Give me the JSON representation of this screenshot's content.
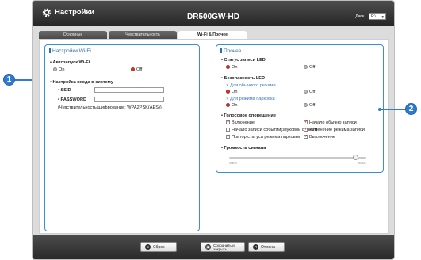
{
  "header": {
    "app_title": "Настройки",
    "model": "DR500GW-HD",
    "disk_label": "Диск :",
    "disk_value": "F:\\"
  },
  "tabs": [
    {
      "label": "Основные"
    },
    {
      "label": "Чувствительность"
    },
    {
      "label": "Wi-Fi & Прочее",
      "active": true
    }
  ],
  "wifi": {
    "title": "Настройки Wi-Fi",
    "autostart_label": "• Автозапуск Wi-Fi",
    "on_label": "On",
    "off_label": "Off",
    "autostart_value": "Off",
    "login_label": "• Настройка входа в систему",
    "ssid_label": "• SSID",
    "ssid_value": "",
    "password_label": "• PASSWORD",
    "password_value": "",
    "hint": "(Чувствительность/шифрование: WPA2PSK(AES))"
  },
  "misc": {
    "title": "Прочее",
    "led_label": "• Статус записи LED",
    "led_value": "On",
    "security_led_label": "• Безопасность LED",
    "normal_mode_label": "Для обычного режима",
    "normal_mode_value": "On",
    "parking_mode_label": "Для режима парковки",
    "parking_mode_value": "On",
    "on_label": "On",
    "off_label": "Off",
    "voice_label": "• Голосовое оповещение",
    "voice_options": [
      {
        "label": "Включение",
        "checked": true
      },
      {
        "label": "Начало обычно записи",
        "checked": true
      },
      {
        "label": "Начало записи событий(звуковой сигнал)",
        "checked": false
      },
      {
        "label": "Изменение режима записи",
        "checked": true
      },
      {
        "label": "Повтор статуса режима парковки",
        "checked": true
      },
      {
        "label": "Выключение",
        "checked": true
      }
    ],
    "volume_label": "• Громкость сигнала",
    "volume_min": "0мин",
    "volume_max": "Макс",
    "volume_level": 0.93
  },
  "footer": {
    "reset_label": "Сброс",
    "save_label": "Сохранить и закрыть",
    "cancel_label": "Отмена"
  },
  "callouts": {
    "one": "1",
    "two": "2"
  },
  "colors": {
    "accent": "#3b8fd1",
    "radio_on": "#d9391f",
    "header": "#333333"
  }
}
